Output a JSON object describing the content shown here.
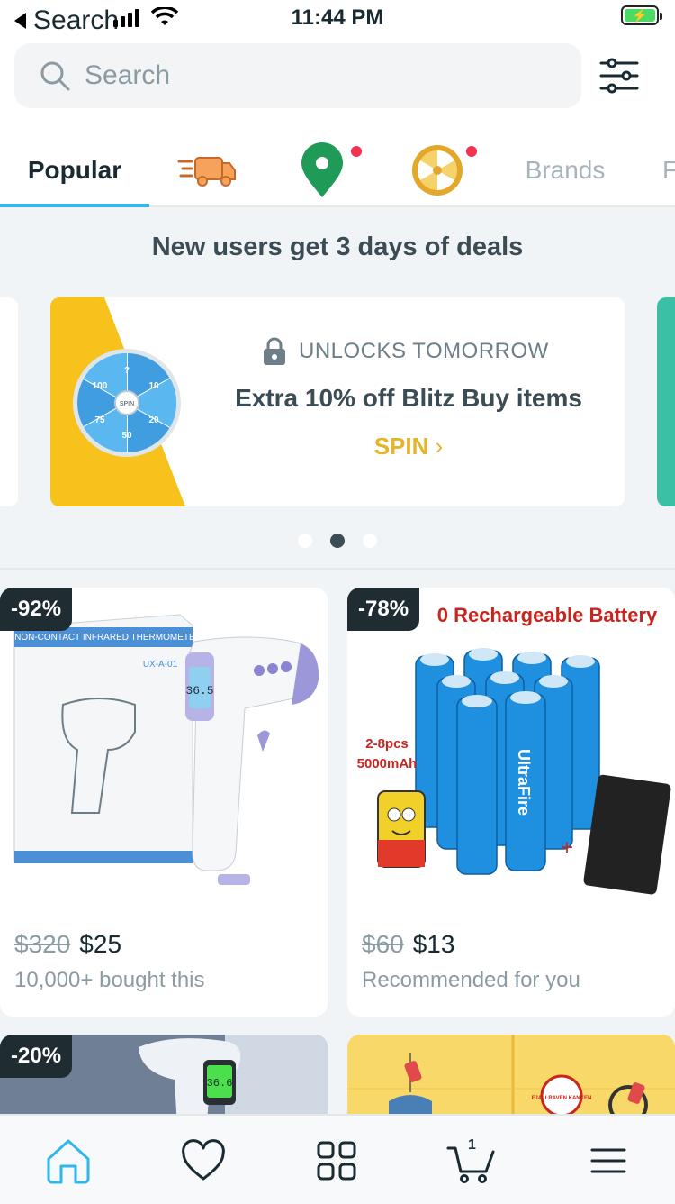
{
  "status_bar": {
    "back_label": "Search",
    "time": "11:44 PM"
  },
  "search": {
    "placeholder": "Search"
  },
  "tabs": [
    {
      "label": "Popular"
    },
    {
      "icon": "fast-shipping-icon"
    },
    {
      "icon": "location-pin-icon"
    },
    {
      "icon": "spin-wheel-icon"
    },
    {
      "label": "Brands"
    },
    {
      "label": "F"
    }
  ],
  "deals": {
    "title": "New users get 3 days of deals",
    "card": {
      "status": "UNLOCKS TOMORROW",
      "headline": "Extra 10% off Blitz Buy items",
      "cta": "SPIN",
      "wheel_labels": [
        "?",
        "10",
        "20",
        "50",
        "75",
        "100"
      ],
      "wheel_center": "SPIN"
    }
  },
  "products": [
    {
      "discount": "-92%",
      "old_price": "$320",
      "price": "$25",
      "subtitle": "10,000+ bought this",
      "image": {
        "box_title": "NON-CONTACT INFRARED THERMOMETER",
        "model": "UX-A-01",
        "reading": "36.5"
      }
    },
    {
      "discount": "-78%",
      "old_price": "$60",
      "price": "$13",
      "subtitle": "Recommended for you",
      "image": {
        "banner": "0 Rechargeable Battery",
        "pack": "2-8pcs",
        "capacity": "5000mAh",
        "brand": "UltraFire"
      }
    },
    {
      "discount": "-20%",
      "image": {
        "reading": "36.6"
      }
    },
    {
      "image": {
        "brand": "FJALLRAVEN KANKEN"
      }
    }
  ],
  "nav": {
    "cart_count": "1"
  },
  "colors": {
    "accent": "#2fb7ec",
    "spin": "#e5b428",
    "discount_bg": "#1f2d33",
    "badge": "#f0344f"
  }
}
